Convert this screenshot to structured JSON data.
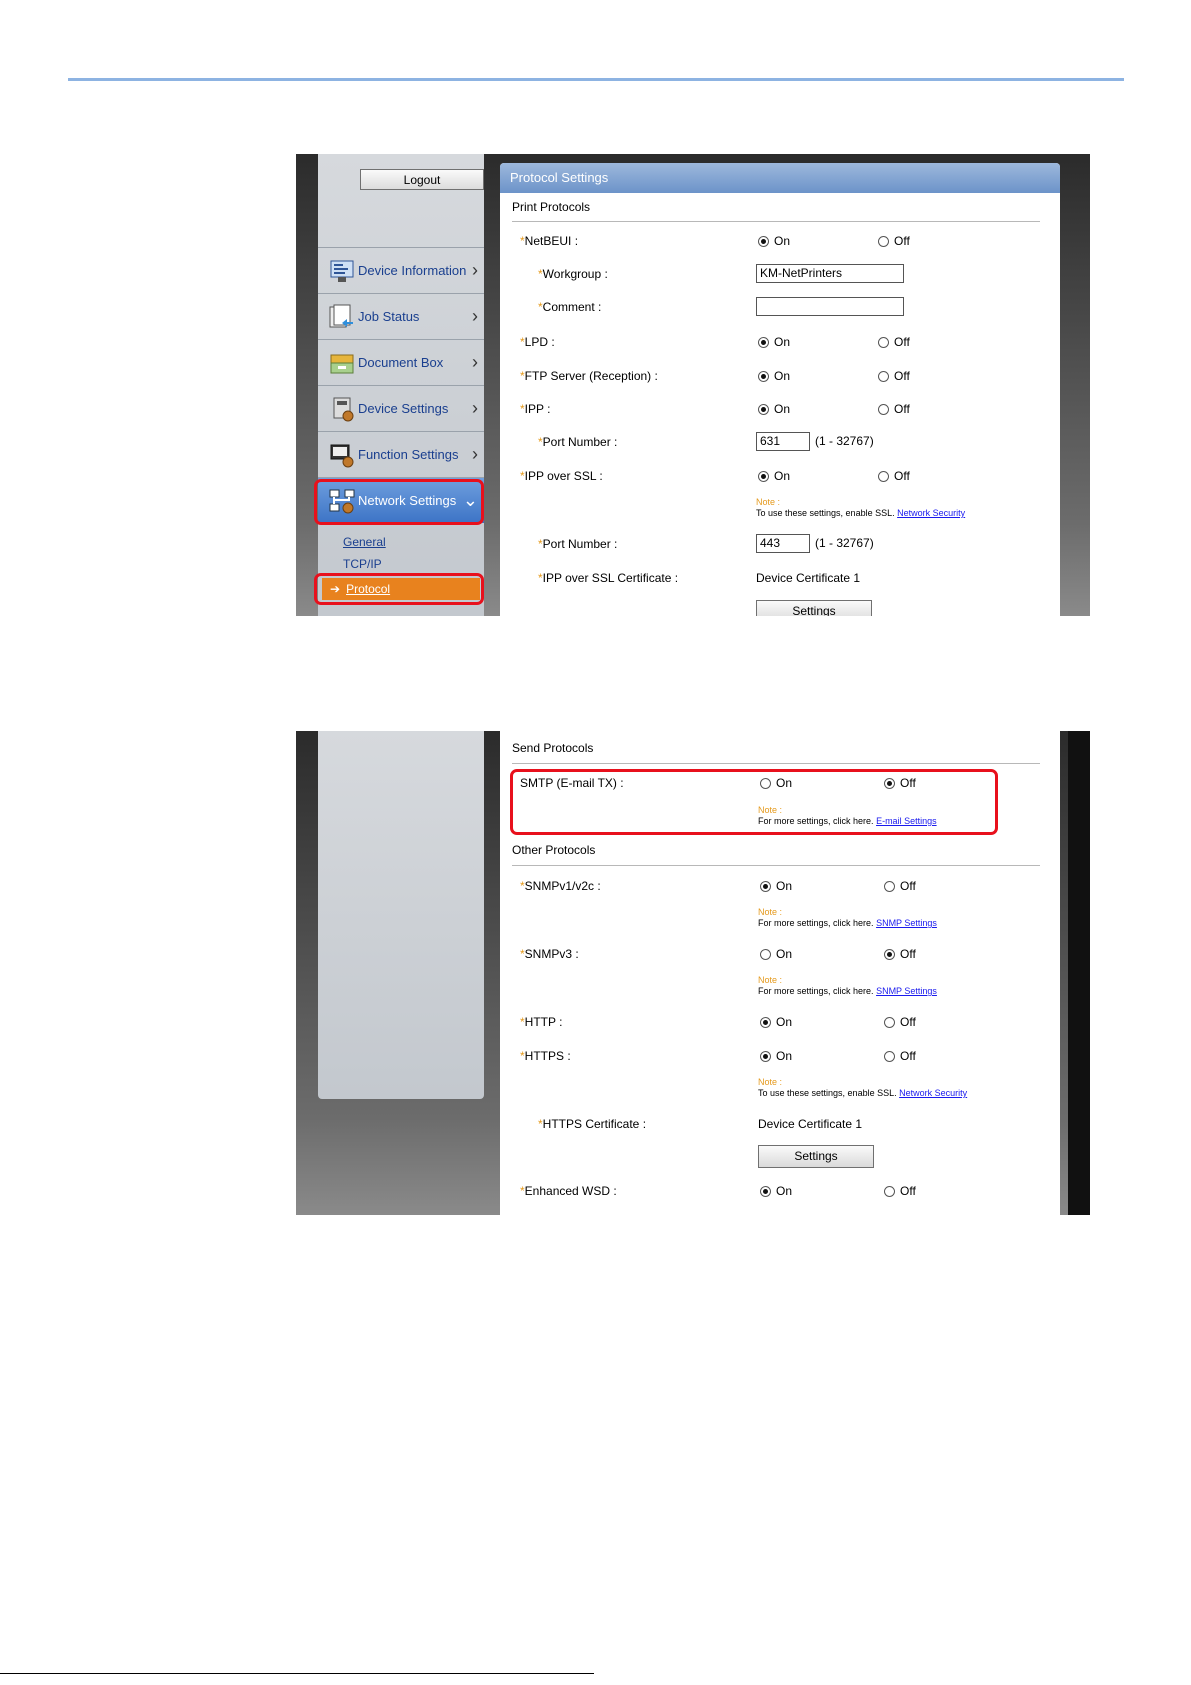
{
  "screen1": {
    "nav": {
      "logout_label": "Logout",
      "items": [
        {
          "label": "Device Information",
          "icon": "device-information-icon"
        },
        {
          "label": "Job Status",
          "icon": "job-status-icon"
        },
        {
          "label": "Document Box",
          "icon": "document-box-icon"
        },
        {
          "label": "Device Settings",
          "icon": "device-settings-icon"
        },
        {
          "label": "Function Settings",
          "icon": "function-settings-icon"
        },
        {
          "label": "Network Settings",
          "icon": "network-settings-icon"
        }
      ],
      "sub_items": [
        "General",
        "TCP/IP",
        "Protocol"
      ]
    },
    "panel": {
      "title": "Protocol Settings",
      "section": "Print Protocols",
      "on_label": "On",
      "off_label": "Off",
      "rows": {
        "netbeui": "NetBEUI :",
        "workgroup": "Workgroup :",
        "workgroup_value": "KM-NetPrinters",
        "comment": "Comment :",
        "comment_value": "",
        "lpd": "LPD :",
        "ftp": "FTP Server (Reception) :",
        "ipp": "IPP :",
        "ipp_port": "Port Number :",
        "ipp_port_value": "631",
        "ipp_range": "(1 - 32767)",
        "ipp_ssl": "IPP over SSL :",
        "ssl_note_title": "Note :",
        "ssl_note_text": "To use these settings, enable SSL.",
        "ssl_note_link": "Network Security",
        "ssl_port": "Port Number :",
        "ssl_port_value": "443",
        "ssl_range": "(1 - 32767)",
        "ssl_cert": "IPP over SSL Certificate :",
        "ssl_cert_value": "Device Certificate 1",
        "settings_label": "Settings"
      }
    }
  },
  "screen2": {
    "send_section": "Send Protocols",
    "other_section": "Other Protocols",
    "on_label": "On",
    "off_label": "Off",
    "smtp": "SMTP (E-mail TX) :",
    "smtp_note_title": "Note :",
    "smtp_note_text": "For more settings, click here.",
    "smtp_note_link": "E-mail Settings",
    "snmpv1": "SNMPv1/v2c :",
    "snmpv1_note_title": "Note :",
    "snmpv1_note_text": "For more settings, click here.",
    "snmpv1_note_link": "SNMP Settings",
    "snmpv3": "SNMPv3 :",
    "snmpv3_note_title": "Note :",
    "snmpv3_note_text": "For more settings, click here.",
    "snmpv3_note_link": "SNMP Settings",
    "http": "HTTP :",
    "https": "HTTPS :",
    "https_note_title": "Note :",
    "https_note_text": "To use these settings, enable SSL.",
    "https_note_link": "Network Security",
    "https_cert": "HTTPS Certificate :",
    "https_cert_value": "Device Certificate 1",
    "settings_label": "Settings",
    "wsd": "Enhanced WSD :"
  },
  "colors": {
    "highlight": "#e8101c",
    "link": "#1a3f8f",
    "active_sub": "#e8821e",
    "note": "#e59a1d"
  }
}
